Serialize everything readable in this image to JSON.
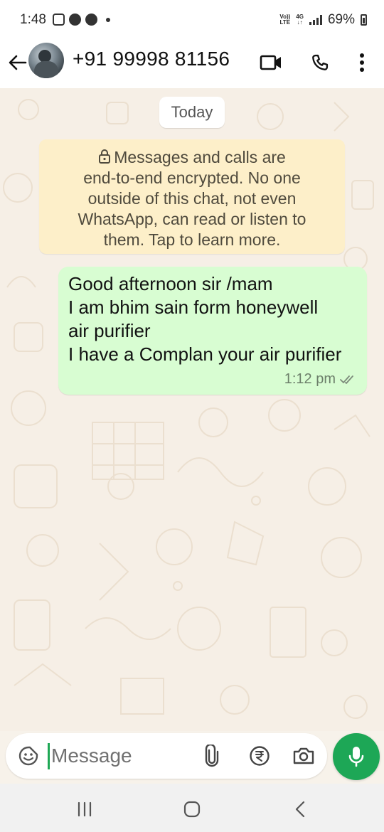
{
  "status_bar": {
    "time": "1:48",
    "network_top": "Vo))",
    "network_bottom": "LTE",
    "network_gen": "4G",
    "battery": "69%"
  },
  "header": {
    "contact_name": "+91 99998 81156",
    "icons": {
      "back": "arrow-left-icon",
      "video": "video-call-icon",
      "voice": "phone-icon",
      "menu": "more-vert-icon"
    }
  },
  "chat": {
    "date_label": "Today",
    "encryption_notice": [
      "Messages and calls are",
      "end-to-end encrypted. No one",
      "outside of this chat, not even",
      "WhatsApp, can read or listen to",
      "them. Tap to learn more."
    ],
    "messages": [
      {
        "lines": [
          "Good afternoon sir /mam",
          "I am bhim sain form honeywell",
          "air purifier",
          "I have a Complan your air purifier"
        ],
        "time": "1:12 pm",
        "status": "double-check-icon"
      }
    ]
  },
  "composer": {
    "placeholder": "Message",
    "icons": {
      "emoji": "sticker-smile-icon",
      "attach": "paperclip-icon",
      "payment": "rupee-icon",
      "camera": "camera-icon",
      "mic": "mic-icon"
    }
  },
  "nav_bar": {
    "icons": [
      "recents-icon",
      "home-icon",
      "back-icon"
    ]
  },
  "colors": {
    "accent": "#1da756",
    "outgoing_bubble": "#d8fdd2",
    "notice_bg": "#fdefc9",
    "chat_bg": "#f6efe6"
  }
}
